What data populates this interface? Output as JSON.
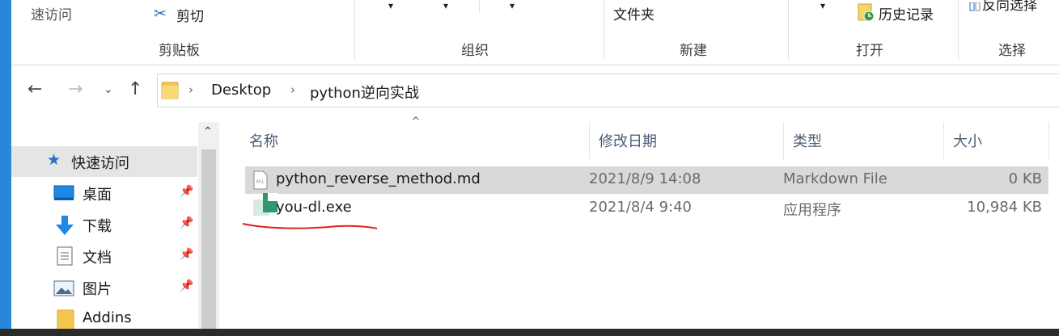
{
  "colors": {
    "accent": "#2a86d8",
    "underline": "#e02020"
  },
  "ribbon": {
    "quick_access": "速访问",
    "cut": "剪切",
    "new_folder": "文件夹",
    "history": "历史记录",
    "select_inverse": "反向选择",
    "group_clipboard": "剪贴板",
    "group_organize": "组织",
    "group_new": "新建",
    "group_open": "打开",
    "group_select": "选择"
  },
  "address": {
    "crumbs": [
      "Desktop",
      "python逆向实战"
    ]
  },
  "nav_pane": {
    "items": [
      {
        "label": "快速访问",
        "icon": "star-icon"
      },
      {
        "label": "桌面",
        "icon": "desktop-icon"
      },
      {
        "label": "下载",
        "icon": "download-arrow-icon"
      },
      {
        "label": "文档",
        "icon": "document-icon"
      },
      {
        "label": "图片",
        "icon": "picture-icon"
      },
      {
        "label": "Addins",
        "icon": "folder-icon"
      }
    ]
  },
  "file_list": {
    "headers": {
      "name": "名称",
      "modified": "修改日期",
      "type": "类型",
      "size": "大小"
    },
    "rows": [
      {
        "name": "python_reverse_method.md",
        "modified": "2021/8/9 14:08",
        "type": "Markdown File",
        "size": "0 KB",
        "selected": true
      },
      {
        "name": "you-dl.exe",
        "modified": "2021/8/4 9:40",
        "type": "应用程序",
        "size": "10,984 KB",
        "selected": false
      }
    ]
  }
}
